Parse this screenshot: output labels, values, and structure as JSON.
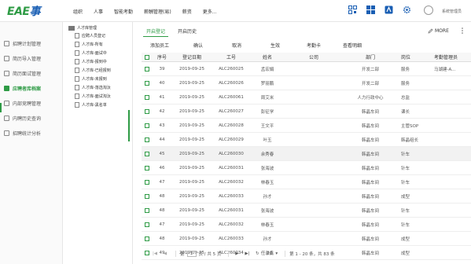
{
  "header": {
    "logo": "EAE事",
    "nav": [
      "组织",
      "人事",
      "智能考勤",
      "薪酬管理(易)",
      "薪资",
      "更多..."
    ],
    "user": "系统管理员",
    "icons": [
      "qr-icon",
      "windows-icon",
      "app-icon",
      "gear-icon"
    ]
  },
  "sidebar": {
    "items": [
      {
        "label": "招聘计划管理",
        "active": false
      },
      {
        "label": "简历导入管理",
        "active": false
      },
      {
        "label": "简历面试管理",
        "active": false
      },
      {
        "label": "应聘者库档案",
        "active": true
      },
      {
        "label": "内部竞聘管理",
        "active": false
      },
      {
        "label": "内聘历史查询",
        "active": false
      },
      {
        "label": "招聘统计分析",
        "active": false
      }
    ]
  },
  "tree": {
    "root": "人才库管理",
    "children": [
      "应聘人员登记",
      "人才库-所有",
      "人才库-面试中",
      "人才库-报到中",
      "人才库-已经报到",
      "人才库-未报到",
      "人才库-落选淘汰",
      "人才库-面试淘汰",
      "人才库-黑名单"
    ]
  },
  "tabs": [
    "开启登记",
    "开启历史"
  ],
  "more_label": "MORE",
  "toolbar": [
    "添加员工",
    "确认",
    "取消",
    "生效",
    "考勤卡",
    "查看明细"
  ],
  "table": {
    "headers": [
      "序号",
      "登记日期",
      "工号",
      "姓名",
      "公司",
      "部门",
      "岗位",
      "考勤管理员"
    ],
    "rows": [
      [
        "39",
        "2019-09-25",
        "ALC260025",
        "孟宏娟",
        "",
        "开发二部",
        "服务",
        "马湖建-A..."
      ],
      [
        "40",
        "2019-09-25",
        "ALC260026",
        "罗丽鹏",
        "",
        "开发二部",
        "服务",
        ""
      ],
      [
        "41",
        "2019-09-25",
        "ALC260061",
        "周艾米",
        "",
        "人力行政中心",
        "总监",
        ""
      ],
      [
        "42",
        "2019-09-25",
        "ALC260027",
        "彭征学",
        "",
        "韩晶车间",
        "课长",
        ""
      ],
      [
        "43",
        "2019-09-25",
        "ALC260028",
        "王文平",
        "",
        "韩晶车间",
        "主管SOP",
        ""
      ],
      [
        "44",
        "2019-09-25",
        "ALC260029",
        "叶玉",
        "",
        "韩晶车间",
        "韩晶组长",
        ""
      ],
      [
        "45",
        "2019-09-25",
        "ALC260030",
        "余秀春",
        "",
        "韩晶车间",
        "针车",
        ""
      ],
      [
        "46",
        "2019-09-25",
        "ALC260031",
        "张海波",
        "",
        "韩晶车间",
        "针车",
        ""
      ],
      [
        "47",
        "2019-09-25",
        "ALC260032",
        "林春玉",
        "",
        "韩晶车间",
        "针车",
        ""
      ],
      [
        "48",
        "2019-09-25",
        "ALC260033",
        "孙才",
        "",
        "韩晶车间",
        "成型",
        ""
      ],
      [
        "48",
        "2019-09-25",
        "ALC260031",
        "张海波",
        "",
        "韩晶车间",
        "针车",
        ""
      ],
      [
        "47",
        "2019-09-25",
        "ALC260032",
        "林春玉",
        "",
        "韩晶车间",
        "针车",
        ""
      ],
      [
        "48",
        "2019-09-25",
        "ALC260033",
        "孙才",
        "",
        "韩晶车间",
        "成型",
        ""
      ],
      [
        "49",
        "2019-09-25",
        "ALC260034",
        "任录鑫",
        "",
        "韩晶车间",
        "成型",
        ""
      ]
    ]
  },
  "pager": {
    "first": "|◀",
    "prev": "◀",
    "page_prefix": "第",
    "page": "1",
    "page_suffix": "页 / 共 5 页",
    "next": "▶",
    "last": "▶|",
    "refresh": "↻",
    "page_size": "20",
    "summary": "第 1 - 20 条，共 83 条"
  },
  "colors": {
    "accent": "#2e9b45",
    "logo_blue": "#1a5fb4",
    "logo_green": "#2e9b45"
  }
}
